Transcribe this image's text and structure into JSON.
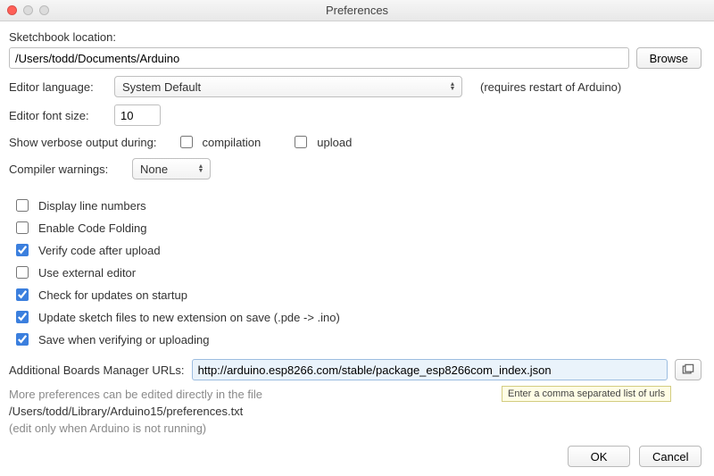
{
  "window": {
    "title": "Preferences"
  },
  "sketchbook": {
    "label": "Sketchbook location:",
    "path": "/Users/todd/Documents/Arduino",
    "browse": "Browse"
  },
  "language": {
    "label": "Editor language:",
    "value": "System Default",
    "note": "(requires restart of Arduino)"
  },
  "fontsize": {
    "label": "Editor font size:",
    "value": "10"
  },
  "verbose": {
    "label": "Show verbose output during:",
    "compilation_label": "compilation",
    "compilation": false,
    "upload_label": "upload",
    "upload": false
  },
  "warnings": {
    "label": "Compiler warnings:",
    "value": "None"
  },
  "options": {
    "display_line_numbers": {
      "label": "Display line numbers",
      "checked": false
    },
    "code_folding": {
      "label": "Enable Code Folding",
      "checked": false
    },
    "verify_upload": {
      "label": "Verify code after upload",
      "checked": true
    },
    "external_editor": {
      "label": "Use external editor",
      "checked": false
    },
    "check_updates": {
      "label": "Check for updates on startup",
      "checked": true
    },
    "update_ext": {
      "label": "Update sketch files to new extension on save (.pde -> .ino)",
      "checked": true
    },
    "save_verify": {
      "label": "Save when verifying or uploading",
      "checked": true
    }
  },
  "boards": {
    "label": "Additional Boards Manager URLs:",
    "value": "http://arduino.esp8266.com/stable/package_esp8266com_index.json",
    "tooltip": "Enter a comma separated list of urls"
  },
  "footer_text": {
    "line1": "More preferences can be edited directly in the file",
    "line2": "/Users/todd/Library/Arduino15/preferences.txt",
    "line3": "(edit only when Arduino is not running)"
  },
  "buttons": {
    "ok": "OK",
    "cancel": "Cancel"
  }
}
